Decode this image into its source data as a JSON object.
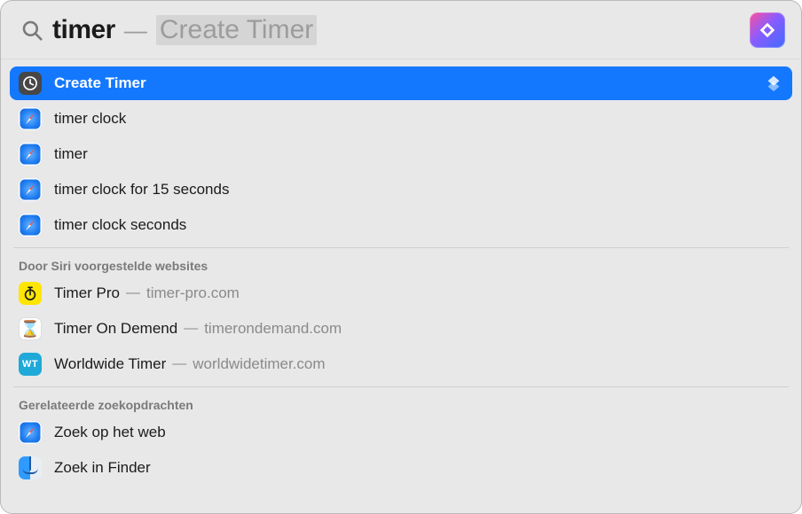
{
  "search": {
    "query": "timer",
    "suggestion_sep": "—",
    "suggestion": "Create Timer"
  },
  "top_hit": {
    "label": "Create Timer"
  },
  "history": {
    "items": [
      {
        "label": "timer clock"
      },
      {
        "label": "timer"
      },
      {
        "label": "timer clock for 15 seconds"
      },
      {
        "label": "timer clock seconds"
      }
    ]
  },
  "siri_sites": {
    "heading": "Door Siri voorgestelde websites",
    "items": [
      {
        "title": "Timer Pro",
        "domain": "timer-pro.com"
      },
      {
        "title": "Timer On Demend",
        "domain": "timerondemand.com"
      },
      {
        "title": "Worldwide Timer",
        "domain": "worldwidetimer.com"
      }
    ]
  },
  "related": {
    "heading": "Gerelateerde zoekopdrachten",
    "items": [
      {
        "label": "Zoek op het web"
      },
      {
        "label": "Zoek in Finder"
      }
    ]
  },
  "dash": "—"
}
